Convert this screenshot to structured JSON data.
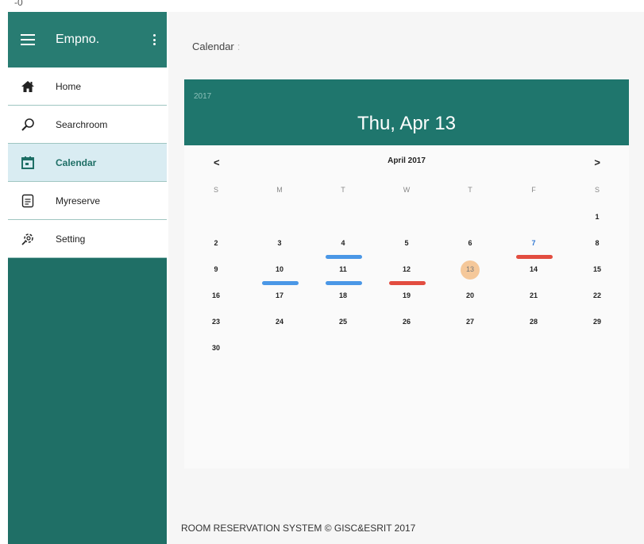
{
  "corner_mark": "-0",
  "sidebar": {
    "title": "Empno.",
    "items": [
      {
        "label": "Home",
        "icon": "home-icon"
      },
      {
        "label": "Searchroom",
        "icon": "search-icon"
      },
      {
        "label": "Calendar",
        "icon": "calendar-icon",
        "active": true
      },
      {
        "label": "Myreserve",
        "icon": "document-icon"
      },
      {
        "label": "Setting",
        "icon": "gear-icon"
      }
    ]
  },
  "main": {
    "breadcrumb": "Calendar",
    "breadcrumb_sep": ":",
    "footer": "ROOM RESERVATION SYSTEM © GISC&ESRIT 2017"
  },
  "calendar": {
    "year": "2017",
    "selected_date": "Thu, Apr 13",
    "month_label": "April 2017",
    "prev_label": "<",
    "next_label": ">",
    "weekdays": [
      "S",
      "M",
      "T",
      "W",
      "T",
      "F",
      "S"
    ],
    "weeks": [
      [
        "",
        "",
        "",
        "",
        "",
        "",
        "1"
      ],
      [
        "2",
        "3",
        "4",
        "5",
        "6",
        "7",
        "8"
      ],
      [
        "9",
        "10",
        "11",
        "12",
        "13",
        "14",
        "15"
      ],
      [
        "16",
        "17",
        "18",
        "19",
        "20",
        "21",
        "22"
      ],
      [
        "23",
        "24",
        "25",
        "26",
        "27",
        "28",
        "29"
      ],
      [
        "30",
        "",
        "",
        "",
        "",
        "",
        ""
      ]
    ],
    "today": "13",
    "blue_numbers": [
      "7"
    ],
    "events": [
      {
        "day": "4",
        "color": "blue",
        "pos": "bottom"
      },
      {
        "day": "7",
        "color": "red",
        "pos": "bottom"
      },
      {
        "day": "10",
        "color": "blue",
        "pos": "bottom"
      },
      {
        "day": "11",
        "color": "blue",
        "pos": "bottom"
      },
      {
        "day": "12",
        "color": "red",
        "pos": "bottom"
      }
    ],
    "colors": {
      "header": "#1f766d",
      "event_blue": "#4a97e6",
      "event_red": "#e24d40",
      "today": "#f5c89a"
    }
  }
}
